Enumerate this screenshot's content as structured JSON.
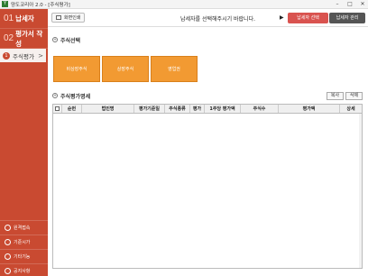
{
  "window": {
    "title": "양도코리아 2.0 - [주식평가]",
    "minimize": "–",
    "maximize": "□",
    "close": "✕"
  },
  "sidebar": {
    "main_items": [
      {
        "num": "01",
        "label": "납세자"
      },
      {
        "num": "02",
        "label": "평가서 작성"
      }
    ],
    "sub_item": {
      "badge": "1",
      "label": "주식평가",
      "chevron": ">"
    },
    "bottom_items": [
      {
        "icon": "remote-support-icon",
        "label": "원격접속"
      },
      {
        "icon": "basic-settings-icon",
        "label": "기준시가"
      },
      {
        "icon": "other-functions-icon",
        "label": "기타기능"
      },
      {
        "icon": "notice-icon",
        "label": "공지사항"
      }
    ]
  },
  "toolbar": {
    "print_label": "화면인쇄",
    "message": "납세자를 선택해주시기 바랍니다.",
    "play_glyph": "▶",
    "select_label": "납세자 선택",
    "manage_label": "납세자 관리"
  },
  "stock_select": {
    "title": "주식선택",
    "buttons": [
      "비상장주식",
      "상장주식",
      "영업권"
    ]
  },
  "stock_eval": {
    "title": "주식평가명세",
    "copy_label": "복사",
    "delete_label": "삭제",
    "columns": [
      "순번",
      "법인명",
      "평가기준일",
      "주식종류",
      "평가",
      "1주당 평가액",
      "주식수",
      "평가액",
      "상세"
    ]
  },
  "colors": {
    "sidebar": "#c94a31",
    "accent_orange": "#f29a32",
    "select_red": "#d9534f",
    "manage_gray": "#555555"
  }
}
